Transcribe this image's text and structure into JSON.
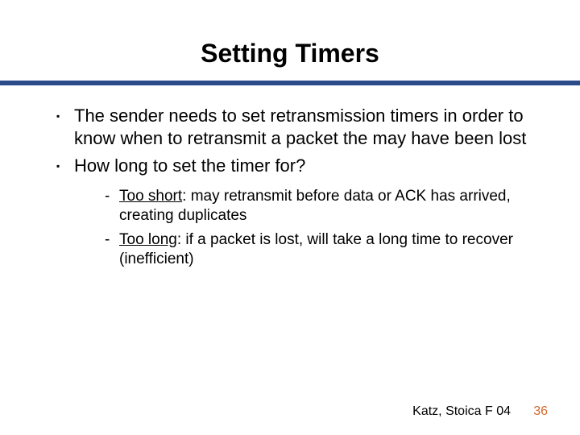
{
  "title": "Setting Timers",
  "bullets": [
    "The sender needs to set retransmission timers in order to know when to retransmit a packet the may have been lost",
    "How long to set the timer for?"
  ],
  "sub": [
    {
      "label": "Too short",
      "rest": ": may retransmit before data or ACK has arrived, creating duplicates"
    },
    {
      "label": "Too long",
      "rest": ": if a packet is lost, will take a long time to recover (inefficient)"
    }
  ],
  "footer": {
    "credit": "Katz, Stoica F 04",
    "page": "36"
  },
  "glyphs": {
    "square": "▪",
    "dash": "-"
  }
}
